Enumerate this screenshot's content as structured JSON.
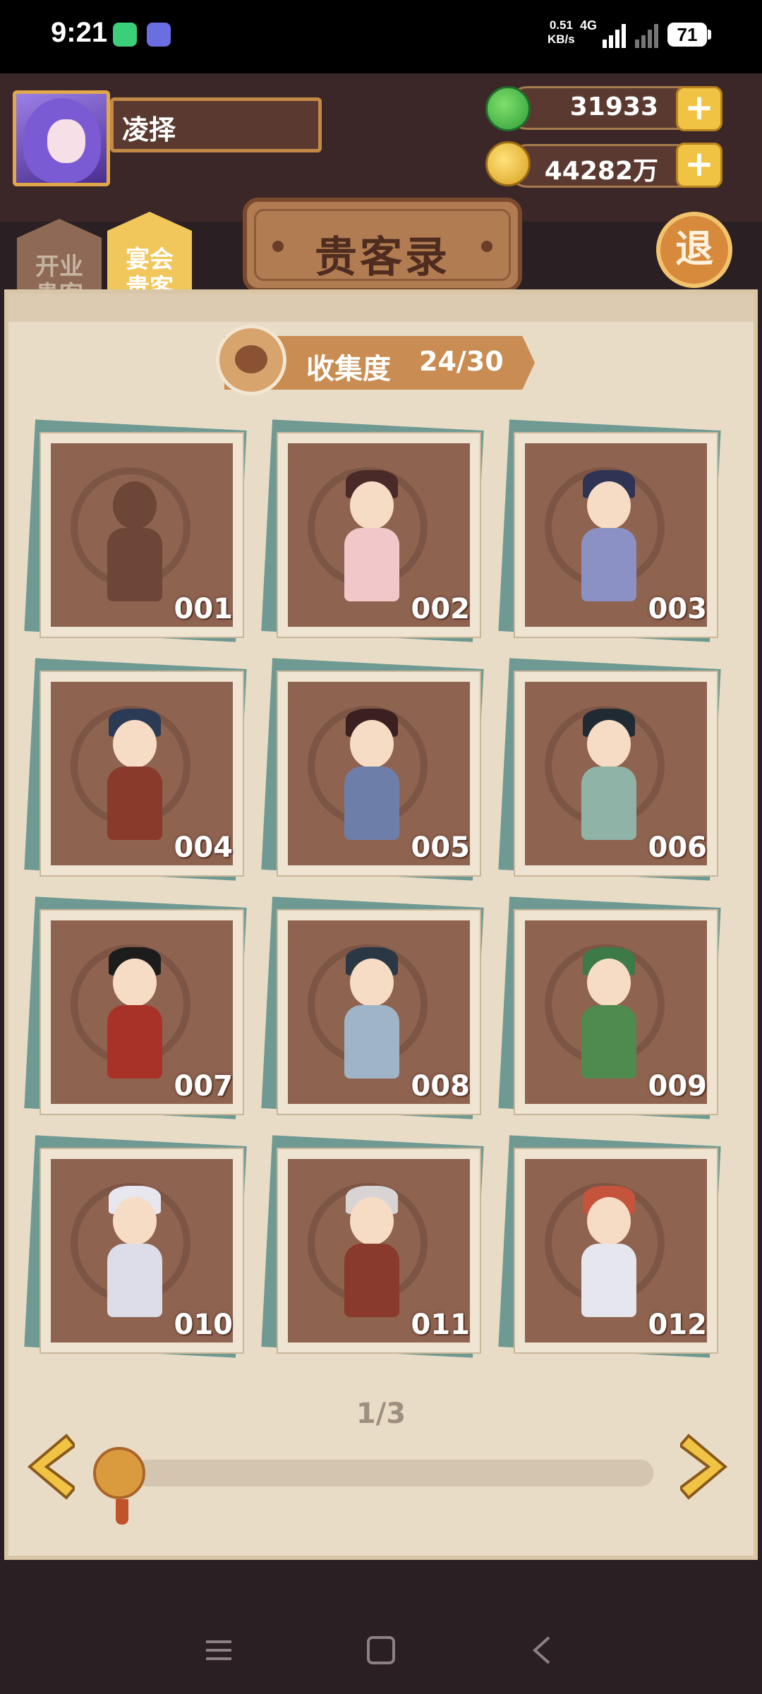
{
  "status": {
    "time": "9:21",
    "net_speed_top": "0.51",
    "net_speed_bottom": "KB/s",
    "signal": "4G",
    "battery": "71"
  },
  "player": {
    "name": "凌择"
  },
  "currencies": [
    {
      "value": "31933",
      "type": "jade-icon"
    },
    {
      "value": "44282万",
      "type": "copper-coin-icon"
    }
  ],
  "tabs": [
    {
      "label": "开业\n贵客",
      "active": false
    },
    {
      "label": "宴会\n贵客",
      "active": true
    }
  ],
  "title": "贵客录",
  "exit_label": "退",
  "collection": {
    "label": "收集度",
    "count": "24/30"
  },
  "cards": [
    {
      "id": "001",
      "locked": true
    },
    {
      "id": "002",
      "locked": false
    },
    {
      "id": "003",
      "locked": false
    },
    {
      "id": "004",
      "locked": false
    },
    {
      "id": "005",
      "locked": false
    },
    {
      "id": "006",
      "locked": false
    },
    {
      "id": "007",
      "locked": false
    },
    {
      "id": "008",
      "locked": false
    },
    {
      "id": "009",
      "locked": false
    },
    {
      "id": "010",
      "locked": false
    },
    {
      "id": "011",
      "locked": false
    },
    {
      "id": "012",
      "locked": false
    }
  ],
  "pager": {
    "text": "1/3"
  },
  "colors": {
    "accent": "#f0c345",
    "panel": "#e9dcc6",
    "card": "#8e6350",
    "dark": "#3b2728"
  }
}
